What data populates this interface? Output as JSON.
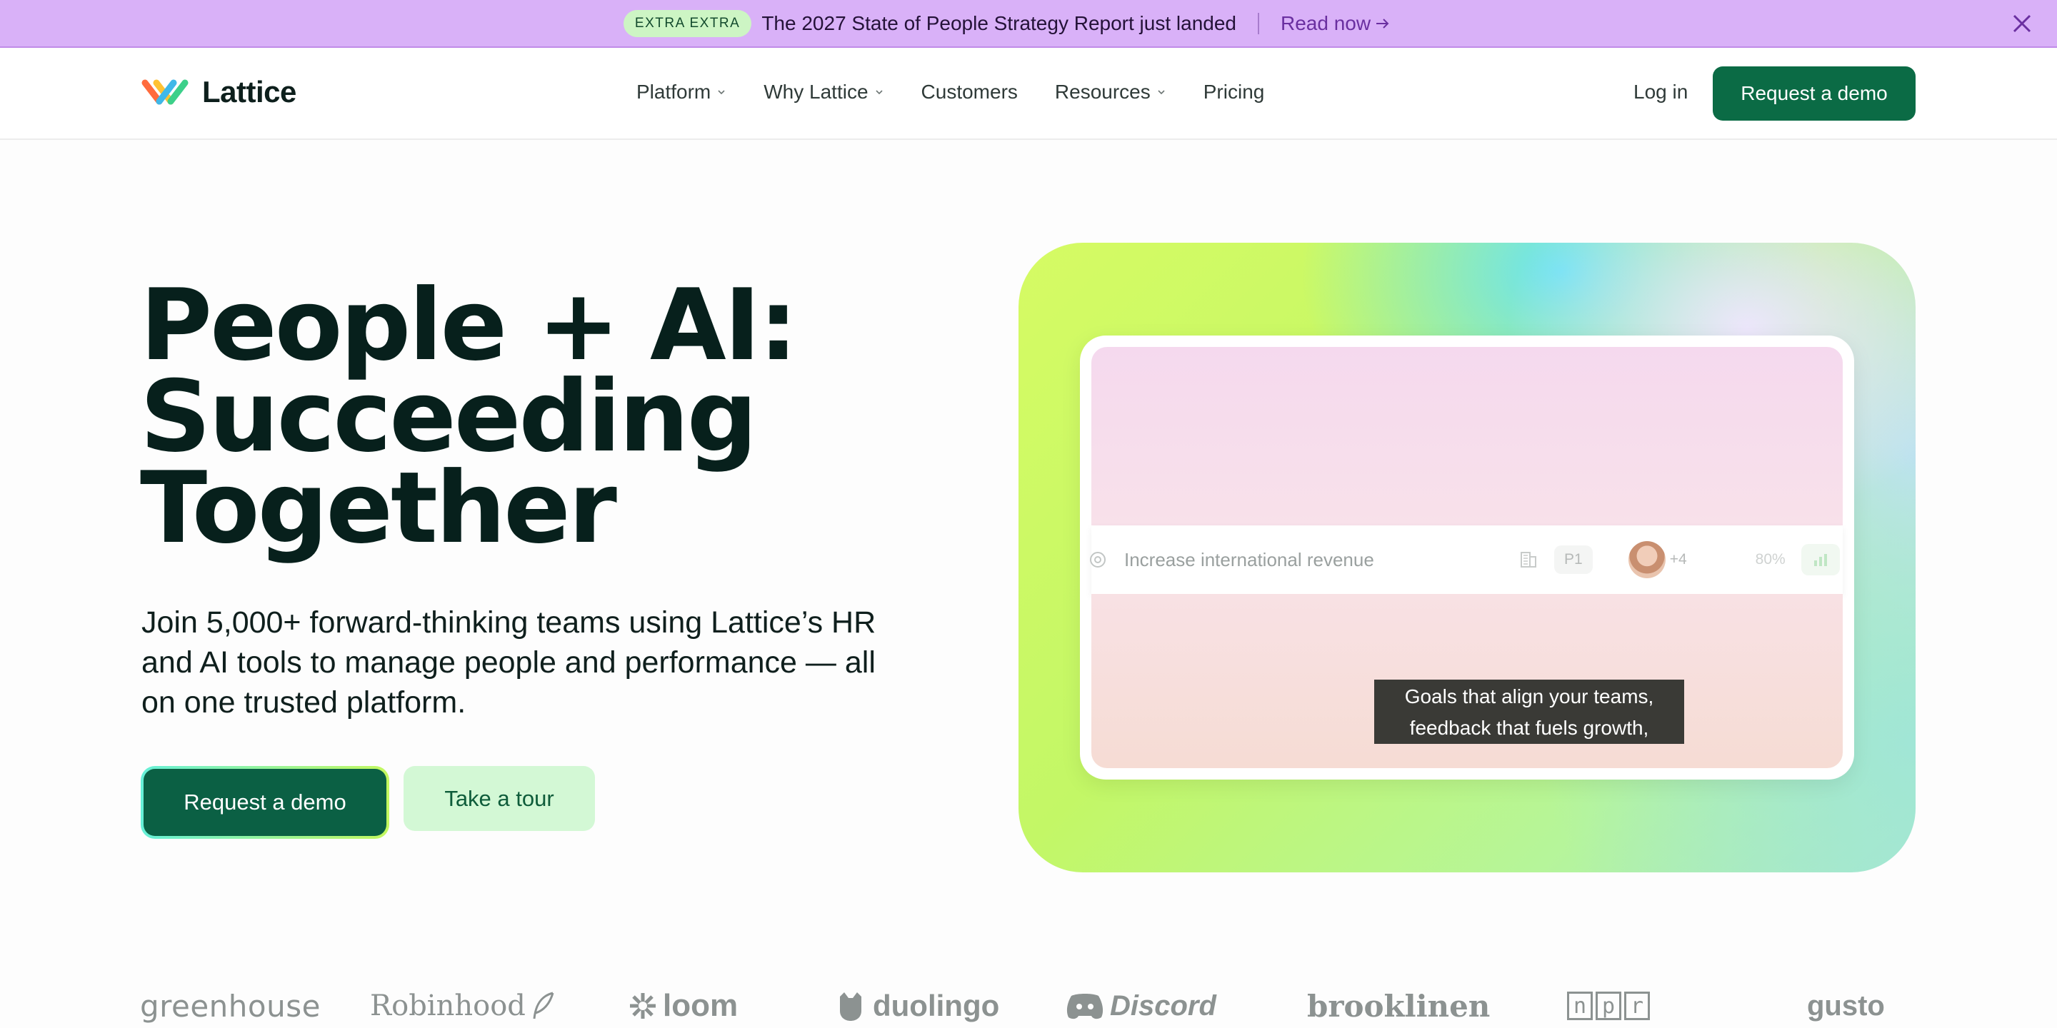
{
  "banner": {
    "badge": "EXTRA EXTRA",
    "text": "The 2027 State of People Strategy Report just landed",
    "link": "Read now"
  },
  "nav": {
    "brand": "Lattice",
    "items": [
      "Platform",
      "Why Lattice",
      "Customers",
      "Resources",
      "Pricing"
    ],
    "login": "Log in",
    "cta": "Request a demo"
  },
  "hero": {
    "title_lines": [
      "People + AI:",
      "Succeeding",
      "Together"
    ],
    "subtitle_lines": [
      "Join 5,000+ forward-thinking teams using Lattice’s HR",
      "and AI tools to manage people and performance — all",
      "on one trusted platform."
    ],
    "primary_cta": "Request a demo",
    "secondary_cta": "Take a tour"
  },
  "visual": {
    "goal": {
      "title": "Increase international revenue",
      "priority": "P1",
      "extra_owners": "+4",
      "progress": "80%"
    },
    "caption_lines": [
      "Goals that align your teams,",
      "feedback that fuels growth,"
    ]
  },
  "logos": [
    "greenhouse",
    "Robinhood",
    "loom",
    "duolingo",
    "Discord",
    "brooklinen",
    "npr",
    "gusto"
  ],
  "colors": {
    "banner_bg": "#d9b1f8",
    "brand_green": "#0b6b45",
    "tour_bg": "#d3f8d5",
    "text_dark": "#07201c"
  }
}
